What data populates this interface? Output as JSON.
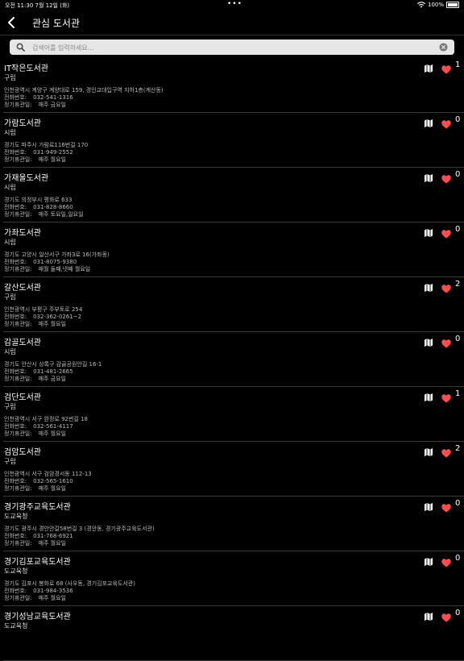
{
  "status": {
    "time": "오전 11:30",
    "date": "7월 12일 (화)",
    "battery": "100%"
  },
  "nav": {
    "title": "관심 도서관"
  },
  "search": {
    "placeholder": "검색어를 입력하세요..."
  },
  "labels": {
    "phone": "전화번호:",
    "closed": "정기휴관일:"
  },
  "libraries": [
    {
      "name": "IT작은도서관",
      "type": "구립",
      "address": "인천광역시 계양구 계양대로 159, 경인교대입구역 지하1층(계산동)",
      "phone": "032-541-1316",
      "closed": "매주 금요일",
      "favorites": "1"
    },
    {
      "name": "가람도서관",
      "type": "시립",
      "address": "경기도 파주시 가람로116번길 170",
      "phone": "031-949-2552",
      "closed": "매주 월요일",
      "favorites": "0"
    },
    {
      "name": "가재울도서관",
      "type": "시립",
      "address": "경기도 의정부시 평화로 633",
      "phone": "031-828-8660",
      "closed": "매주 토요일,일요일",
      "favorites": "0"
    },
    {
      "name": "가좌도서관",
      "type": "시립",
      "address": "경기도 고양시 일산서구 가좌3로 16(가좌동)",
      "phone": "031-8075-9380",
      "closed": "매월 둘째,넷째 월요일",
      "favorites": "0"
    },
    {
      "name": "갈산도서관",
      "type": "구립",
      "address": "인천광역시 부평구 주부토로 254",
      "phone": "032-362-0261~2",
      "closed": "매주 월요일",
      "favorites": "2"
    },
    {
      "name": "감골도서관",
      "type": "시립",
      "address": "경기도 안산시 상록구 감골공원안길 16-1",
      "phone": "031-481-2665",
      "closed": "매주 금요일",
      "favorites": "0"
    },
    {
      "name": "검단도서관",
      "type": "구립",
      "address": "인천광역시 서구 완정로 92번길 18",
      "phone": "032-561-4117",
      "closed": "매주 월요일",
      "favorites": "1"
    },
    {
      "name": "검암도서관",
      "type": "구립",
      "address": "인천광역시 서구 검암경서동 112-13",
      "phone": "032-565-1610",
      "closed": "매주 월요일",
      "favorites": "2"
    },
    {
      "name": "경기광주교육도서관",
      "type": "도교육청",
      "address": "경기도 광주시 경안안길58번길 3 (경안동, 경기광주교육도서관)",
      "phone": "031-768-6921",
      "closed": "매주 월요일",
      "favorites": "0"
    },
    {
      "name": "경기김포교육도서관",
      "type": "도교육청",
      "address": "경기도 김포시 봉화로 68 (사우동, 경기김포교육도서관)",
      "phone": "031-984-3536",
      "closed": "매주 월요일",
      "favorites": "0"
    },
    {
      "name": "경기성남교육도서관",
      "type": "도교육청",
      "address": "",
      "phone": "",
      "closed": "",
      "favorites": "0"
    }
  ]
}
